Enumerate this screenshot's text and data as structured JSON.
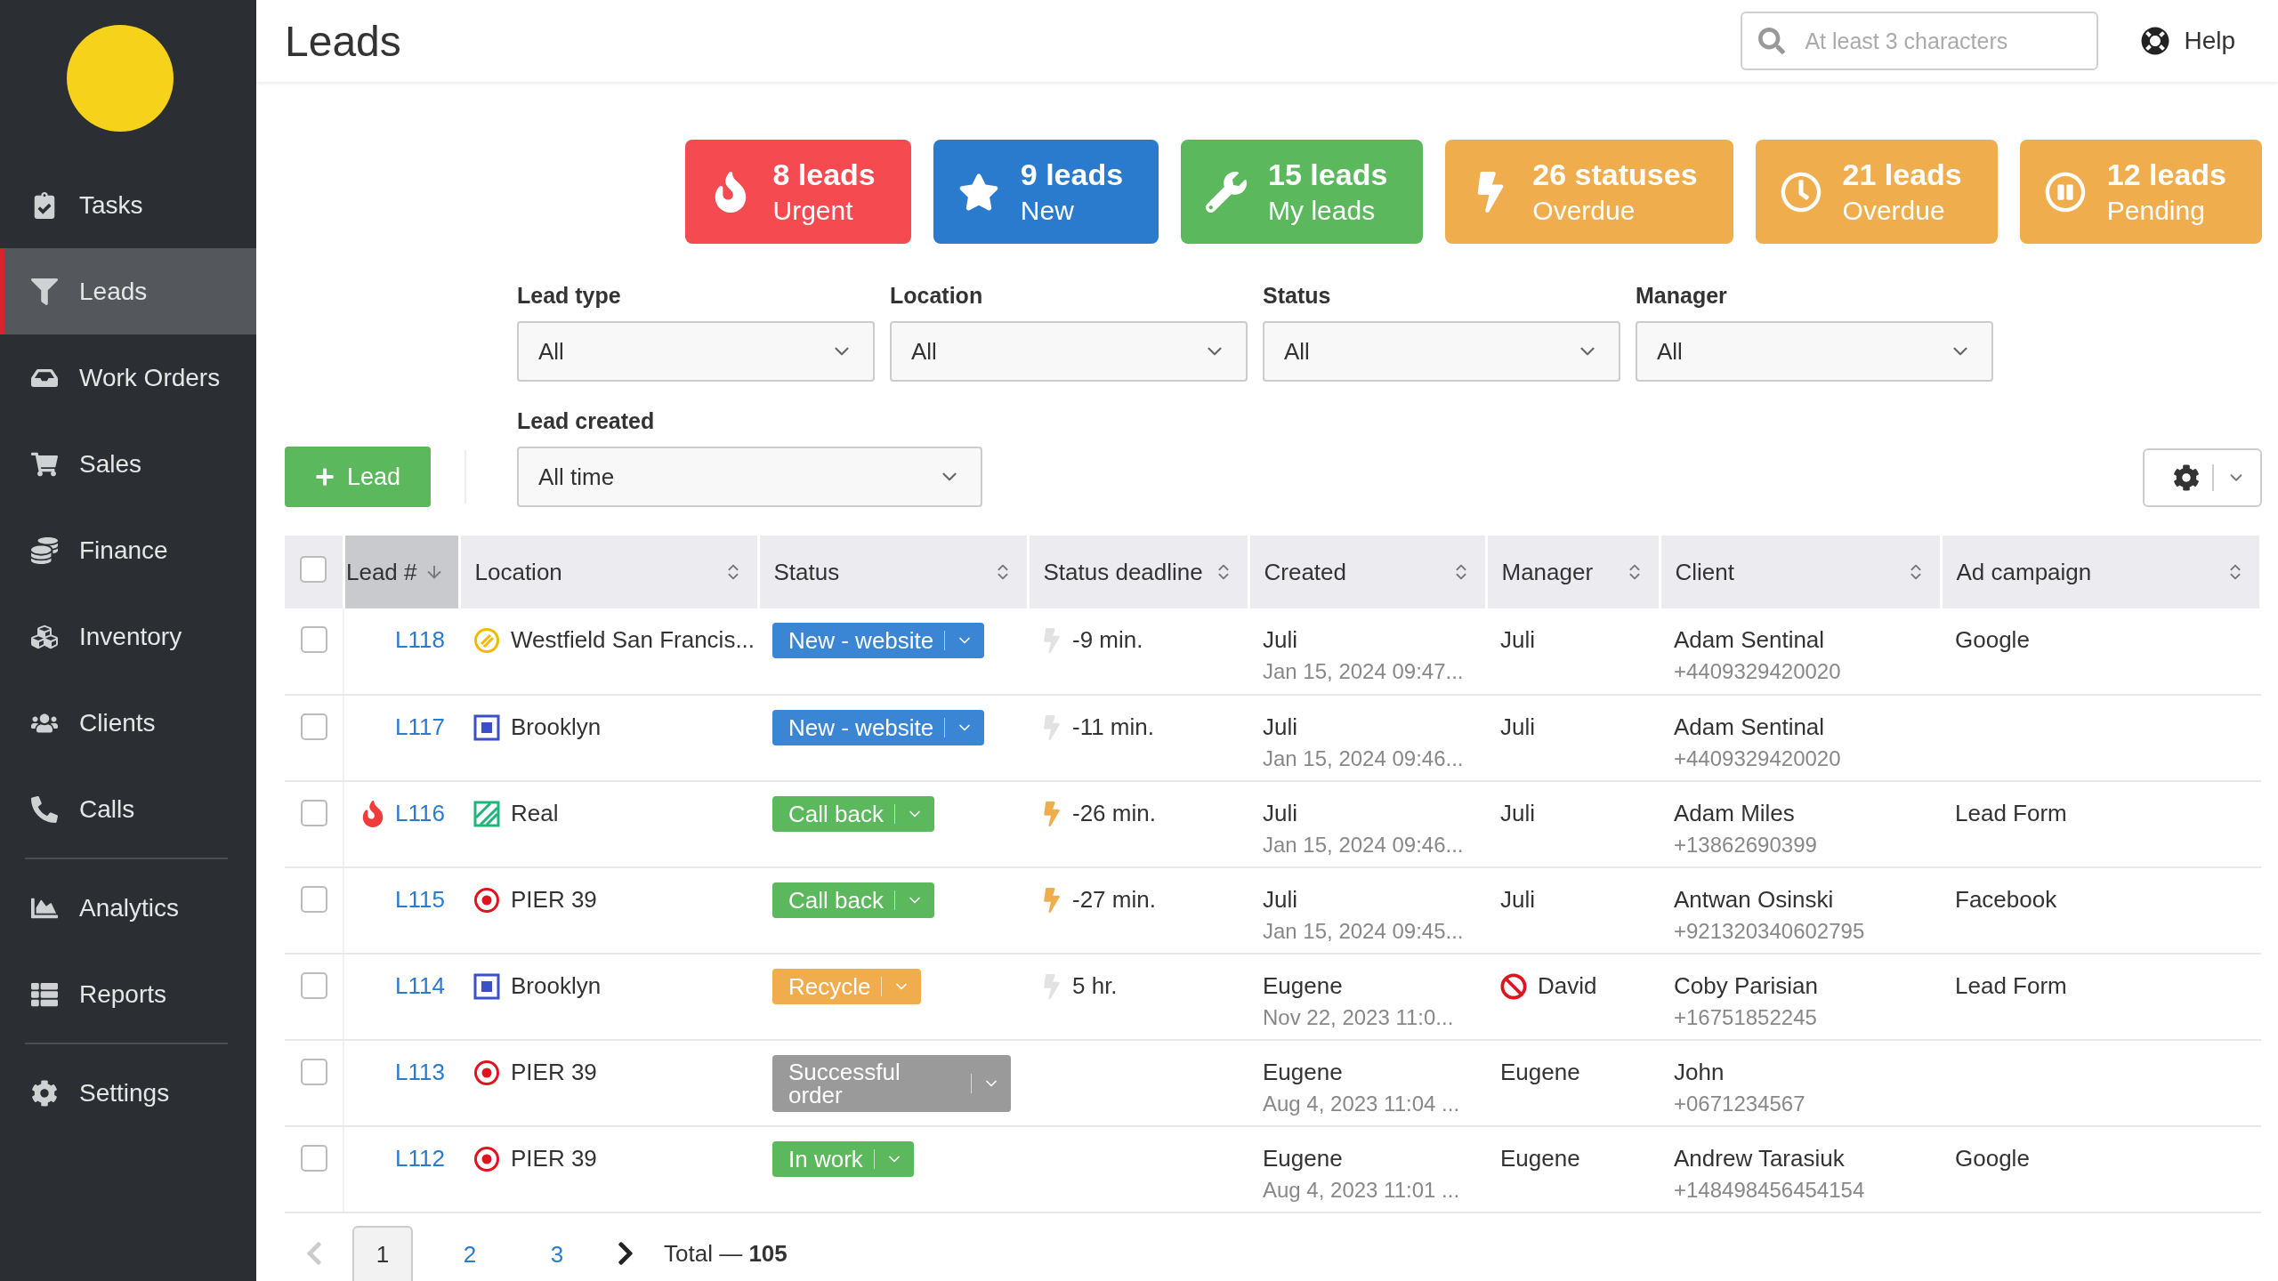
{
  "sidebar": {
    "sections": [
      [
        {
          "label": "Tasks",
          "selected": false
        },
        {
          "label": "Leads",
          "selected": true
        },
        {
          "label": "Work Orders",
          "selected": false
        },
        {
          "label": "Sales",
          "selected": false
        },
        {
          "label": "Finance",
          "selected": false
        },
        {
          "label": "Inventory",
          "selected": false
        },
        {
          "label": "Clients",
          "selected": false
        },
        {
          "label": "Calls",
          "selected": false
        }
      ],
      [
        {
          "label": "Analytics",
          "selected": false
        },
        {
          "label": "Reports",
          "selected": false
        }
      ],
      [
        {
          "label": "Settings",
          "selected": false
        }
      ]
    ]
  },
  "header": {
    "title": "Leads",
    "search": {
      "placeholder": "At least 3 characters"
    },
    "help": "Help"
  },
  "stats": [
    {
      "kind": "fire",
      "count": "8 leads",
      "label": "Urgent",
      "color": "#f44a50"
    },
    {
      "kind": "star",
      "count": "9 leads",
      "label": "New",
      "color": "#2a7bcd"
    },
    {
      "kind": "wrench",
      "count": "15 leads",
      "label": "My leads",
      "color": "#5cb85c"
    },
    {
      "kind": "bolt",
      "count": "26 statuses",
      "label": "Overdue",
      "color": "#f0ad4e"
    },
    {
      "kind": "clock",
      "count": "21 leads",
      "label": "Overdue",
      "color": "#f0ad4e"
    },
    {
      "kind": "pause",
      "count": "12 leads",
      "label": "Pending",
      "color": "#f0ad4e"
    }
  ],
  "filters": [
    {
      "label": "Lead type",
      "value": "All"
    },
    {
      "label": "Location",
      "value": "All"
    },
    {
      "label": "Status",
      "value": "All"
    },
    {
      "label": "Manager",
      "value": "All"
    }
  ],
  "lead_created": {
    "label": "Lead created",
    "value": "All time"
  },
  "add_button": "Lead",
  "table": {
    "all_checked": false,
    "columns": [
      {
        "label": "Lead #",
        "sorted": true
      },
      {
        "label": "Location",
        "sorted": false
      },
      {
        "label": "Status",
        "sorted": false
      },
      {
        "label": "Status deadline",
        "sorted": false
      },
      {
        "label": "Created",
        "sorted": false
      },
      {
        "label": "Manager",
        "sorted": false
      },
      {
        "label": "Client",
        "sorted": false
      },
      {
        "label": "Ad campaign",
        "sorted": false
      }
    ],
    "rows": [
      {
        "checked": false,
        "urgent": false,
        "id": "L118",
        "location": {
          "name": "Westfield San Francis...",
          "kind": "striped",
          "color": "#f5b800"
        },
        "status": {
          "label": "New - website",
          "color": "#3a86d4"
        },
        "deadline": {
          "text": "-9 min.",
          "overdue": false
        },
        "created": {
          "by": "Juli",
          "date": "Jan 15, 2024 09:47..."
        },
        "manager": {
          "name": "Juli",
          "blocked": false
        },
        "client": {
          "name": "Adam Sentinal",
          "phone": "+4409329420020"
        },
        "campaign": "Google"
      },
      {
        "checked": false,
        "urgent": false,
        "id": "L117",
        "location": {
          "name": "Brooklyn",
          "kind": "square",
          "color": "#3a4fc8"
        },
        "status": {
          "label": "New - website",
          "color": "#3a86d4"
        },
        "deadline": {
          "text": "-11 min.",
          "overdue": false
        },
        "created": {
          "by": "Juli",
          "date": "Jan 15, 2024 09:46..."
        },
        "manager": {
          "name": "Juli",
          "blocked": false
        },
        "client": {
          "name": "Adam Sentinal",
          "phone": "+4409329420020"
        }
      },
      {
        "checked": false,
        "urgent": true,
        "id": "L116",
        "location": {
          "name": "Real",
          "kind": "hatched",
          "color": "#1fb57a"
        },
        "status": {
          "label": "Call back",
          "color": "#5cb85c"
        },
        "deadline": {
          "text": "-26 min.",
          "overdue": true
        },
        "created": {
          "by": "Juli",
          "date": "Jan 15, 2024 09:46..."
        },
        "manager": {
          "name": "Juli",
          "blocked": false
        },
        "client": {
          "name": "Adam Miles",
          "phone": "+13862690399"
        },
        "campaign": "Lead Form"
      },
      {
        "checked": false,
        "urgent": false,
        "id": "L115",
        "location": {
          "name": "PIER 39",
          "kind": "target",
          "color": "#e0141e"
        },
        "status": {
          "label": "Call back",
          "color": "#5cb85c"
        },
        "deadline": {
          "text": "-27 min.",
          "overdue": true
        },
        "created": {
          "by": "Juli",
          "date": "Jan 15, 2024 09:45..."
        },
        "manager": {
          "name": "Juli",
          "blocked": false
        },
        "client": {
          "name": "Antwan Osinski",
          "phone": "+921320340602795"
        },
        "campaign": "Facebook"
      },
      {
        "checked": false,
        "urgent": false,
        "id": "L114",
        "location": {
          "name": "Brooklyn",
          "kind": "square",
          "color": "#3a4fc8"
        },
        "status": {
          "label": "Recycle",
          "color": "#f0ad4e"
        },
        "deadline": {
          "text": "5 hr.",
          "overdue": false
        },
        "created": {
          "by": "Eugene",
          "date": "Nov 22, 2023 11:0..."
        },
        "manager": {
          "name": "David",
          "blocked": true
        },
        "client": {
          "name": "Coby Parisian",
          "phone": "+16751852245"
        },
        "campaign": "Lead Form"
      },
      {
        "checked": false,
        "urgent": false,
        "id": "L113",
        "location": {
          "name": "PIER 39",
          "kind": "target",
          "color": "#e0141e"
        },
        "status": {
          "label": "Successful order",
          "color": "#9a9a9a"
        },
        "created": {
          "by": "Eugene",
          "date": "Aug 4, 2023 11:04 ..."
        },
        "manager": {
          "name": "Eugene",
          "blocked": false
        },
        "client": {
          "name": "John",
          "phone": "+0671234567"
        }
      },
      {
        "checked": false,
        "urgent": false,
        "id": "L112",
        "location": {
          "name": "PIER 39",
          "kind": "target",
          "color": "#e0141e"
        },
        "status": {
          "label": "In work",
          "color": "#5cb85c"
        },
        "created": {
          "by": "Eugene",
          "date": "Aug 4, 2023 11:01 ..."
        },
        "manager": {
          "name": "Eugene",
          "blocked": false
        },
        "client": {
          "name": "Andrew Tarasiuk",
          "phone": "+148498456454154"
        },
        "campaign": "Google"
      }
    ]
  },
  "pagination": {
    "pages": [
      {
        "label": "1",
        "selected": true
      },
      {
        "label": "2",
        "selected": false
      },
      {
        "label": "3",
        "selected": false
      }
    ],
    "total": "Total — **105**"
  }
}
